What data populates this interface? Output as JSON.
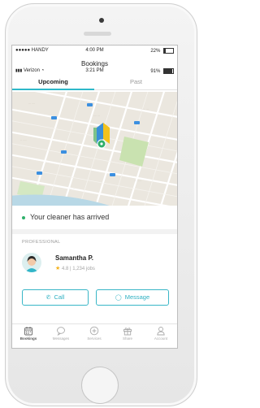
{
  "status_top": {
    "carrier": "●●●●● HANDY",
    "time": "4:00 PM",
    "battery": "22%"
  },
  "title": "Bookings",
  "status_inner": {
    "carrier": "Verizon",
    "time": "3:21 PM",
    "battery": "91%"
  },
  "tabs": [
    {
      "label": "Upcoming",
      "active": true
    },
    {
      "label": "Past",
      "active": false
    }
  ],
  "arrival_status": "Your cleaner has arrived",
  "professional": {
    "section_label": "PROFESSIONAL",
    "name": "Samantha P.",
    "rating": "4.8",
    "jobs": "1,234 jobs"
  },
  "actions": {
    "call": "Call",
    "message": "Message"
  },
  "bottom_nav": [
    {
      "label": "Bookings",
      "icon": "calendar-icon",
      "active": true
    },
    {
      "label": "Messages",
      "icon": "chat-icon",
      "active": false
    },
    {
      "label": "Services",
      "icon": "plus-circle-icon",
      "active": false
    },
    {
      "label": "Share",
      "icon": "gift-icon",
      "active": false
    },
    {
      "label": "Account",
      "icon": "person-icon",
      "active": false
    }
  ],
  "colors": {
    "accent": "#2eb8c9",
    "status_dot": "#2fb06a",
    "star": "#f5b21b"
  }
}
